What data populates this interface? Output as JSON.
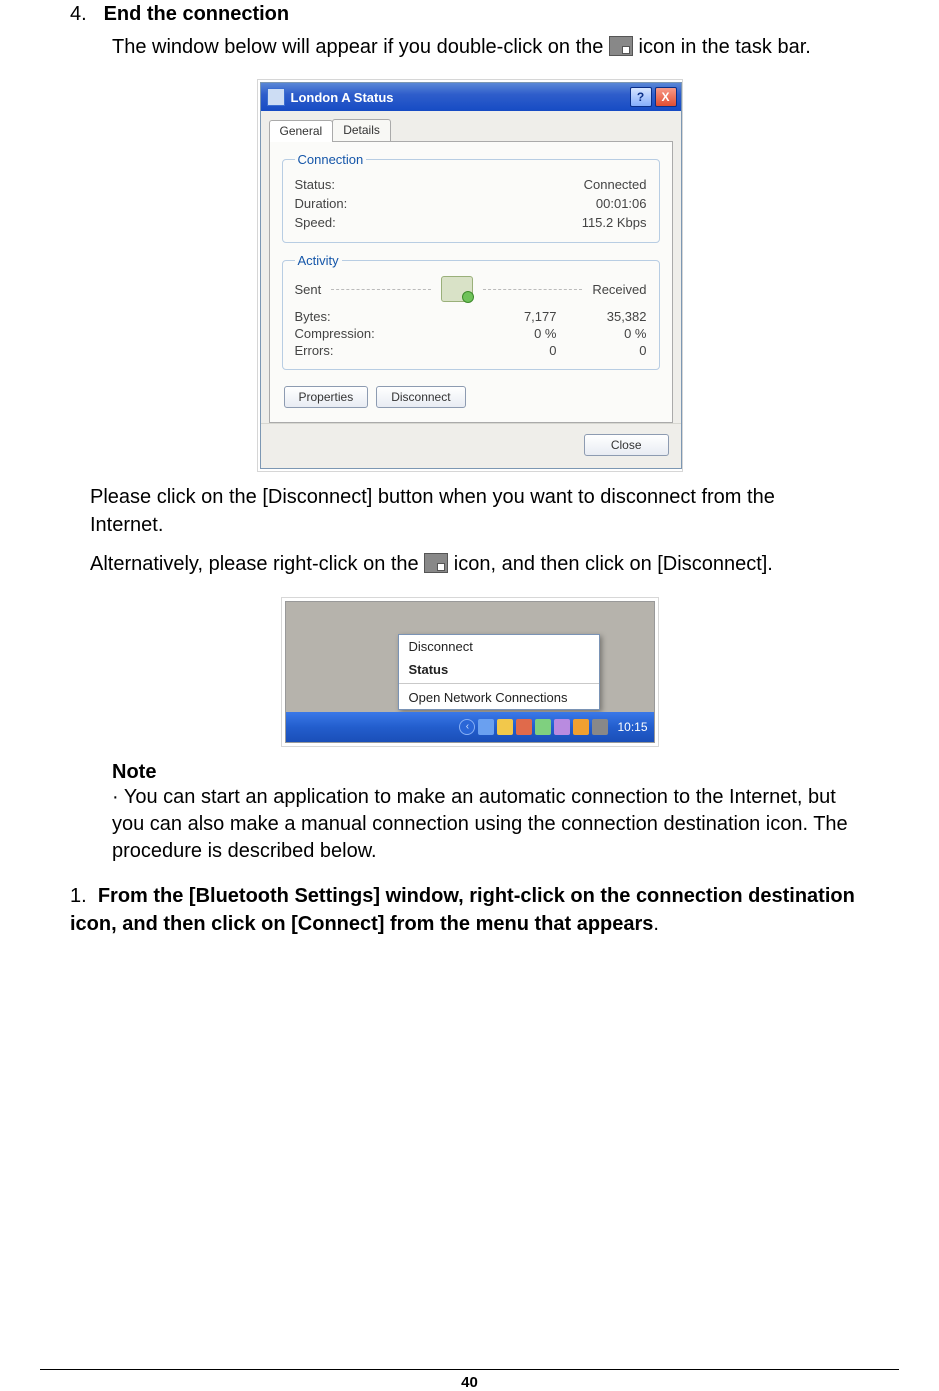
{
  "step4": {
    "number": "4.",
    "title": "End the connection",
    "intro_1": "The window below will appear if you double-click on the",
    "intro_2": "icon in the task bar."
  },
  "status_dialog": {
    "title": "London A Status",
    "help": "?",
    "close": "X",
    "tabs": {
      "general": "General",
      "details": "Details"
    },
    "connection": {
      "legend": "Connection",
      "status_lbl": "Status:",
      "status_val": "Connected",
      "duration_lbl": "Duration:",
      "duration_val": "00:01:06",
      "speed_lbl": "Speed:",
      "speed_val": "115.2 Kbps"
    },
    "activity": {
      "legend": "Activity",
      "sent": "Sent",
      "received": "Received",
      "bytes_lbl": "Bytes:",
      "bytes_sent": "7,177",
      "bytes_recv": "35,382",
      "comp_lbl": "Compression:",
      "comp_sent": "0 %",
      "comp_recv": "0 %",
      "err_lbl": "Errors:",
      "err_sent": "0",
      "err_recv": "0"
    },
    "buttons": {
      "properties": "Properties",
      "disconnect": "Disconnect",
      "close": "Close"
    }
  },
  "after": {
    "p1": "Please click on the [Disconnect] button when you want to disconnect from the Internet.",
    "p2a": "Alternatively, please right-click on the",
    "p2b": "icon, and then click on [Disconnect]."
  },
  "context_menu": {
    "disconnect": "Disconnect",
    "status": "Status",
    "open": "Open Network Connections",
    "clock": "10:15"
  },
  "note": {
    "heading": "Note",
    "body": "· You can start an application to make an automatic connection to the Internet, but you can also make a manual connection using the connection destination icon. The procedure is described below."
  },
  "step1": {
    "number": "1.",
    "text": "From the [Bluetooth Settings] window, right-click on the connection destination icon, and then click on [Connect] from the menu that appears"
  },
  "page_number": "40"
}
